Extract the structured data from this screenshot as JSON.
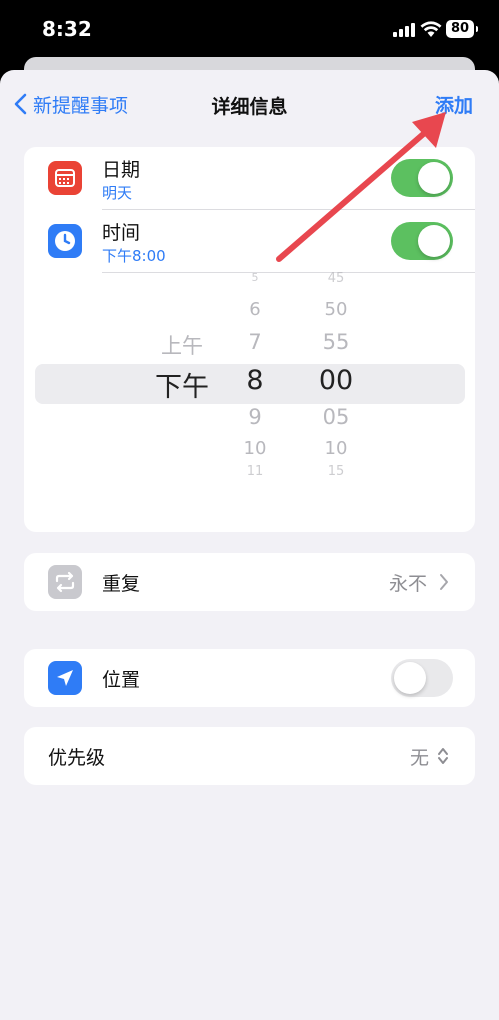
{
  "status": {
    "time": "8:32",
    "battery": "80"
  },
  "nav": {
    "back_label": "新提醒事项",
    "title": "详细信息",
    "add_label": "添加"
  },
  "date_row": {
    "title": "日期",
    "subtitle": "明天",
    "toggle": "on"
  },
  "time_row": {
    "title": "时间",
    "subtitle": "下午8:00",
    "toggle": "on"
  },
  "picker": {
    "ampm": [
      "上午",
      "下午"
    ],
    "hours": [
      "5",
      "6",
      "7",
      "8",
      "9",
      "10",
      "11"
    ],
    "minutes": [
      "45",
      "50",
      "55",
      "00",
      "05",
      "10",
      "15"
    ],
    "selected_ampm": "下午",
    "selected_hour": "8",
    "selected_minute": "00"
  },
  "repeat_row": {
    "title": "重复",
    "value": "永不"
  },
  "location_row": {
    "title": "位置",
    "toggle": "off"
  },
  "priority_row": {
    "title": "优先级",
    "value": "无"
  },
  "colors": {
    "accent": "#2f7cf6",
    "toggle_on": "#5cc060",
    "calendar_icon": "#ea4335",
    "arrow": "#e8474f"
  }
}
